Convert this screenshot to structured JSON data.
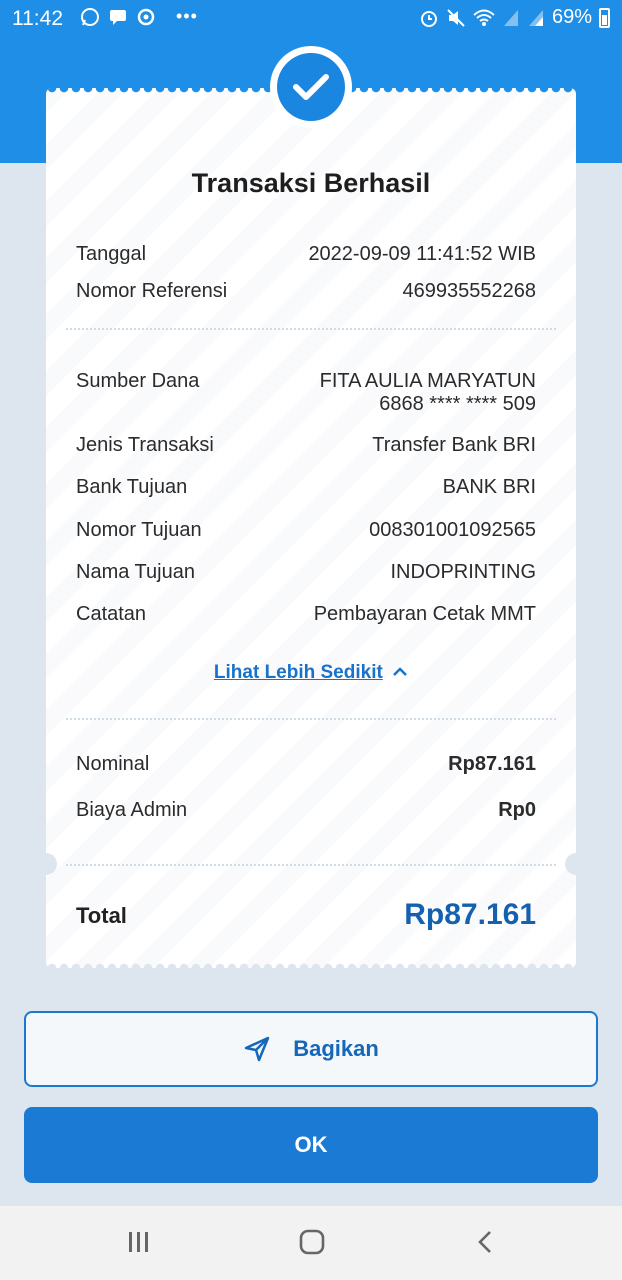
{
  "status_bar": {
    "time": "11:42",
    "battery": "69%",
    "icons_left": [
      "whatsapp-icon",
      "message-icon",
      "sync-icon",
      "more-icon"
    ],
    "icons_right": [
      "alarm-icon",
      "mute-icon",
      "wifi-icon",
      "signal-icon",
      "signal-icon",
      "battery-icon"
    ]
  },
  "colors": {
    "brand_blue": "#1f8ee6",
    "button_blue": "#1a7ad4",
    "total_blue": "#1461b0",
    "background": "#dde6ee"
  },
  "receipt": {
    "title": "Transaksi Berhasil",
    "watermark": "BRI",
    "header_rows": [
      {
        "label": "Tanggal",
        "value": "2022-09-09 11:41:52 WIB"
      },
      {
        "label": "Nomor Referensi",
        "value": "469935552268"
      }
    ],
    "detail_rows": [
      {
        "label": "Sumber Dana",
        "value": "FITA AULIA MARYATUN",
        "value2": "6868 **** **** 509"
      },
      {
        "label": "Jenis Transaksi",
        "value": "Transfer Bank BRI"
      },
      {
        "label": "Bank Tujuan",
        "value": "BANK BRI"
      },
      {
        "label": "Nomor Tujuan",
        "value": "008301001092565"
      },
      {
        "label": "Nama Tujuan",
        "value": "INDOPRINTING"
      },
      {
        "label": "Catatan",
        "value": "Pembayaran Cetak MMT"
      }
    ],
    "toggle_link": "Lihat Lebih Sedikit",
    "amount_rows": [
      {
        "label": "Nominal",
        "value": "Rp87.161"
      },
      {
        "label": "Biaya Admin",
        "value": "Rp0"
      }
    ],
    "total_label": "Total",
    "total_value": "Rp87.161"
  },
  "buttons": {
    "share_label": "Bagikan",
    "ok_label": "OK"
  },
  "nav_bar": {
    "items": [
      "recent-apps-icon",
      "home-icon",
      "back-icon"
    ]
  }
}
